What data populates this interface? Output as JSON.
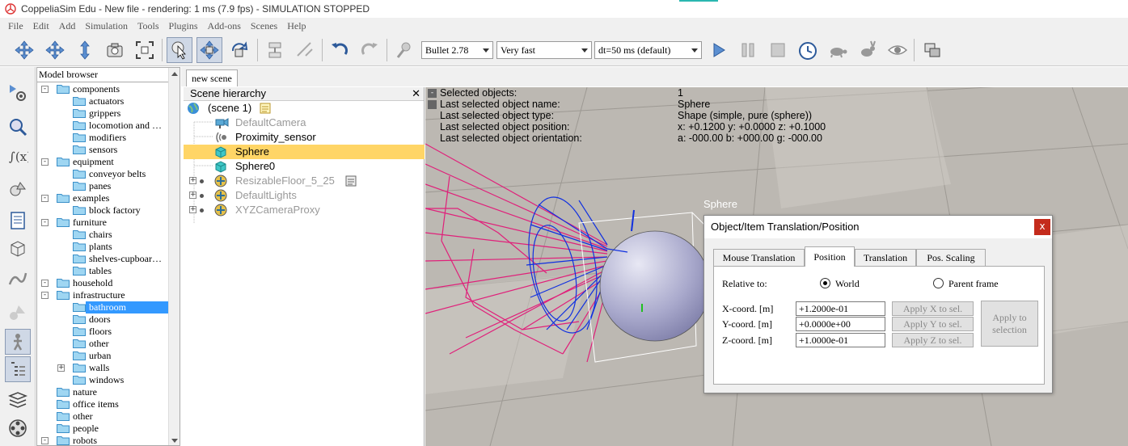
{
  "window": {
    "title": "CoppeliaSim Edu - New file - rendering: 1 ms (7.9 fps) - SIMULATION STOPPED"
  },
  "menu": [
    "File",
    "Edit",
    "Add",
    "Simulation",
    "Tools",
    "Plugins",
    "Add-ons",
    "Scenes",
    "Help"
  ],
  "toolbar": {
    "engine": "Bullet 2.78",
    "speed": "Very fast",
    "timestep": "dt=50 ms (default)"
  },
  "model_browser": {
    "title": "Model browser",
    "items": [
      {
        "label": "components",
        "level": 0,
        "expander": "-"
      },
      {
        "label": "actuators",
        "level": 1
      },
      {
        "label": "grippers",
        "level": 1
      },
      {
        "label": "locomotion and …",
        "level": 1
      },
      {
        "label": "modifiers",
        "level": 1
      },
      {
        "label": "sensors",
        "level": 1
      },
      {
        "label": "equipment",
        "level": 0,
        "expander": "-"
      },
      {
        "label": "conveyor belts",
        "level": 1
      },
      {
        "label": "panes",
        "level": 1
      },
      {
        "label": "examples",
        "level": 0,
        "expander": "-"
      },
      {
        "label": "block factory",
        "level": 1
      },
      {
        "label": "furniture",
        "level": 0,
        "expander": "-"
      },
      {
        "label": "chairs",
        "level": 1
      },
      {
        "label": "plants",
        "level": 1
      },
      {
        "label": "shelves-cupboar…",
        "level": 1
      },
      {
        "label": "tables",
        "level": 1
      },
      {
        "label": "household",
        "level": 0,
        "expander": "-"
      },
      {
        "label": "infrastructure",
        "level": 0,
        "expander": "-"
      },
      {
        "label": "bathroom",
        "level": 1,
        "selected": true
      },
      {
        "label": "doors",
        "level": 1
      },
      {
        "label": "floors",
        "level": 1
      },
      {
        "label": "other",
        "level": 1
      },
      {
        "label": "urban",
        "level": 1
      },
      {
        "label": "walls",
        "level": 1,
        "expander": "+"
      },
      {
        "label": "windows",
        "level": 1
      },
      {
        "label": "nature",
        "level": 0
      },
      {
        "label": "office items",
        "level": 0
      },
      {
        "label": "other",
        "level": 0
      },
      {
        "label": "people",
        "level": 0
      },
      {
        "label": "robots",
        "level": 0,
        "expander": "-"
      }
    ]
  },
  "scene_tab": "new scene",
  "hierarchy": {
    "title": "Scene hierarchy",
    "close": "✕",
    "items": [
      {
        "label": "(scene 1)",
        "icon": "globe-icon"
      },
      {
        "label": "DefaultCamera",
        "icon": "camera-icon",
        "dim": true
      },
      {
        "label": "Proximity_sensor",
        "icon": "proximity-sensor-icon"
      },
      {
        "label": "Sphere",
        "icon": "shape-icon",
        "selected": true
      },
      {
        "label": "Sphere0",
        "icon": "shape-icon"
      },
      {
        "label": "ResizableFloor_5_25",
        "icon": "dummy-icon",
        "dim": true
      },
      {
        "label": "DefaultLights",
        "icon": "dummy-icon",
        "dim": true
      },
      {
        "label": "XYZCameraProxy",
        "icon": "dummy-icon",
        "dim": true
      }
    ]
  },
  "viewport": {
    "info": [
      {
        "key": "Selected objects:",
        "value": "1"
      },
      {
        "key": "Last selected object name:",
        "value": "Sphere"
      },
      {
        "key": "Last selected object type:",
        "value": "Shape (simple, pure (sphere))"
      },
      {
        "key": "Last selected object position:",
        "value": "x: +0.1200    y: +0.0000    z: +0.1000"
      },
      {
        "key": "Last selected object orientation:",
        "value": "a: -000.00    b: +000.00    g: -000.00"
      }
    ],
    "object_label": "Sphere"
  },
  "dialog": {
    "title": "Object/Item Translation/Position",
    "close": "x",
    "tabs": [
      "Mouse Translation",
      "Position",
      "Translation",
      "Pos. Scaling"
    ],
    "active_tab": "Position",
    "relative_to_label": "Relative to:",
    "world_label": "World",
    "parent_label": "Parent frame",
    "x_label": "X-coord. [m]",
    "y_label": "Y-coord. [m]",
    "z_label": "Z-coord. [m]",
    "x_value": "+1.2000e-01",
    "y_value": "+0.0000e+00",
    "z_value": "+1.0000e-01",
    "apply_x": "Apply X to sel.",
    "apply_y": "Apply Y to sel.",
    "apply_z": "Apply Z to sel.",
    "apply_sel_1": "Apply to",
    "apply_sel_2": "selection"
  }
}
